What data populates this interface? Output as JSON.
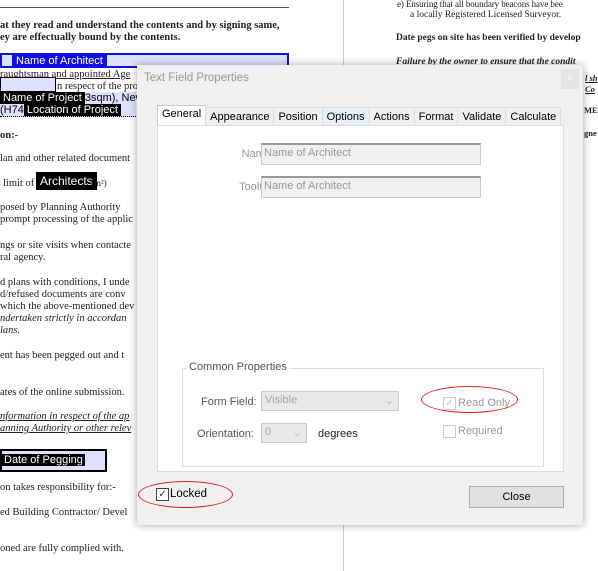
{
  "left_page": {
    "lines": [
      "at they read and understand the contents and by signing same,",
      "ey are effectually bound by the contents.",
      "raughtsman and appointed Age",
      "n respect of the pro",
      "on:-",
      "lan and other related document",
      "limit of",
      "(m²)",
      "posed by Planning Authority",
      "prompt processing of the applic",
      "ngs or site visits when contacte",
      "ral agency.",
      "d plans with conditions, I unde",
      "d/refused documents are conv",
      "which the above-mentioned dev",
      "ndertaken strictly in accordan",
      "lans.",
      "ent has been pegged out and t",
      "ates of the online submission.",
      "nformation in respect of the ap",
      "anning Authority or other relev",
      "on takes responsibility for:-",
      "ed Building Contractor/ Devel",
      "oned are fully complied with."
    ],
    "fields": {
      "architect": "Name of Architect",
      "project": "Name of Project",
      "sqm": "3sqm), New",
      "h74": "(H74",
      "location": "Location of Project",
      "architects": "Architects",
      "date": "Date of Pegging"
    }
  },
  "right_page": {
    "lines": [
      "e)  Ensuring that all boundary beacons have bee",
      "a locally Registered Licensed Surveyor.",
      "Date pegs on site has been verified by develop",
      "Failure by the owner to ensure that the condit",
      "l sh",
      "Co",
      "ME",
      "gne"
    ]
  },
  "dialog": {
    "title": "Text Field Properties",
    "close_x": "×",
    "tabs": [
      "General",
      "Appearance",
      "Position",
      "Options",
      "Actions",
      "Format",
      "Validate",
      "Calculate"
    ],
    "active_tab": "General",
    "name_label": "Name:",
    "name_value": "Name of Architect",
    "tooltip_label": "Tooltip:",
    "tooltip_value": "Name of Architect",
    "common_title": "Common Properties",
    "form_field_label": "Form Field:",
    "form_field_value": "Visible",
    "orientation_label": "Orientation:",
    "orientation_value": "0",
    "degrees": "degrees",
    "read_only": "Read Only",
    "read_only_checked": true,
    "required": "Required",
    "required_checked": false,
    "locked": "Locked",
    "locked_checked": true,
    "close_button": "Close",
    "highlight_color": "#e02020"
  }
}
